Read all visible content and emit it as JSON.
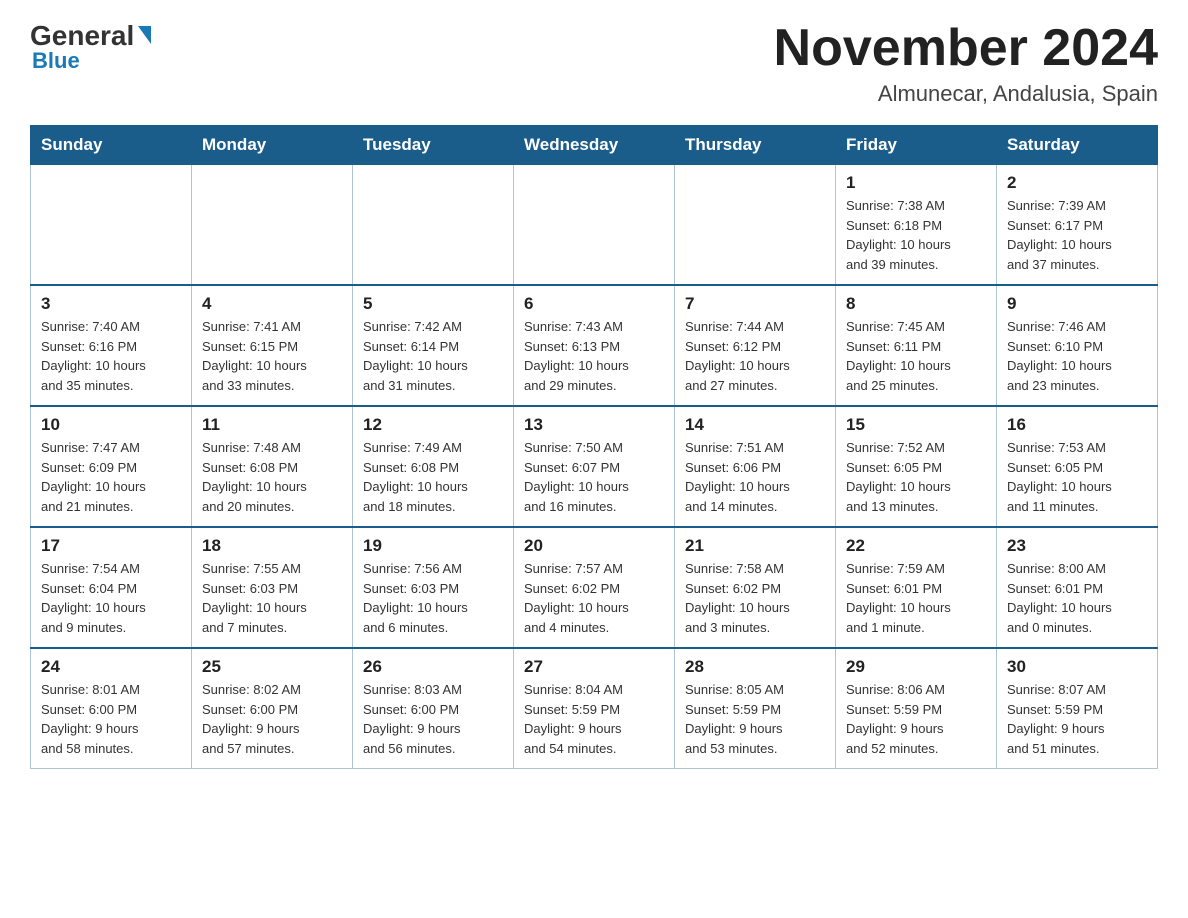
{
  "header": {
    "logo_text_general": "General",
    "logo_text_blue": "Blue",
    "month_title": "November 2024",
    "location": "Almunecar, Andalusia, Spain"
  },
  "weekdays": [
    "Sunday",
    "Monday",
    "Tuesday",
    "Wednesday",
    "Thursday",
    "Friday",
    "Saturday"
  ],
  "weeks": [
    {
      "days": [
        {
          "num": "",
          "info": ""
        },
        {
          "num": "",
          "info": ""
        },
        {
          "num": "",
          "info": ""
        },
        {
          "num": "",
          "info": ""
        },
        {
          "num": "",
          "info": ""
        },
        {
          "num": "1",
          "info": "Sunrise: 7:38 AM\nSunset: 6:18 PM\nDaylight: 10 hours\nand 39 minutes."
        },
        {
          "num": "2",
          "info": "Sunrise: 7:39 AM\nSunset: 6:17 PM\nDaylight: 10 hours\nand 37 minutes."
        }
      ]
    },
    {
      "days": [
        {
          "num": "3",
          "info": "Sunrise: 7:40 AM\nSunset: 6:16 PM\nDaylight: 10 hours\nand 35 minutes."
        },
        {
          "num": "4",
          "info": "Sunrise: 7:41 AM\nSunset: 6:15 PM\nDaylight: 10 hours\nand 33 minutes."
        },
        {
          "num": "5",
          "info": "Sunrise: 7:42 AM\nSunset: 6:14 PM\nDaylight: 10 hours\nand 31 minutes."
        },
        {
          "num": "6",
          "info": "Sunrise: 7:43 AM\nSunset: 6:13 PM\nDaylight: 10 hours\nand 29 minutes."
        },
        {
          "num": "7",
          "info": "Sunrise: 7:44 AM\nSunset: 6:12 PM\nDaylight: 10 hours\nand 27 minutes."
        },
        {
          "num": "8",
          "info": "Sunrise: 7:45 AM\nSunset: 6:11 PM\nDaylight: 10 hours\nand 25 minutes."
        },
        {
          "num": "9",
          "info": "Sunrise: 7:46 AM\nSunset: 6:10 PM\nDaylight: 10 hours\nand 23 minutes."
        }
      ]
    },
    {
      "days": [
        {
          "num": "10",
          "info": "Sunrise: 7:47 AM\nSunset: 6:09 PM\nDaylight: 10 hours\nand 21 minutes."
        },
        {
          "num": "11",
          "info": "Sunrise: 7:48 AM\nSunset: 6:08 PM\nDaylight: 10 hours\nand 20 minutes."
        },
        {
          "num": "12",
          "info": "Sunrise: 7:49 AM\nSunset: 6:08 PM\nDaylight: 10 hours\nand 18 minutes."
        },
        {
          "num": "13",
          "info": "Sunrise: 7:50 AM\nSunset: 6:07 PM\nDaylight: 10 hours\nand 16 minutes."
        },
        {
          "num": "14",
          "info": "Sunrise: 7:51 AM\nSunset: 6:06 PM\nDaylight: 10 hours\nand 14 minutes."
        },
        {
          "num": "15",
          "info": "Sunrise: 7:52 AM\nSunset: 6:05 PM\nDaylight: 10 hours\nand 13 minutes."
        },
        {
          "num": "16",
          "info": "Sunrise: 7:53 AM\nSunset: 6:05 PM\nDaylight: 10 hours\nand 11 minutes."
        }
      ]
    },
    {
      "days": [
        {
          "num": "17",
          "info": "Sunrise: 7:54 AM\nSunset: 6:04 PM\nDaylight: 10 hours\nand 9 minutes."
        },
        {
          "num": "18",
          "info": "Sunrise: 7:55 AM\nSunset: 6:03 PM\nDaylight: 10 hours\nand 7 minutes."
        },
        {
          "num": "19",
          "info": "Sunrise: 7:56 AM\nSunset: 6:03 PM\nDaylight: 10 hours\nand 6 minutes."
        },
        {
          "num": "20",
          "info": "Sunrise: 7:57 AM\nSunset: 6:02 PM\nDaylight: 10 hours\nand 4 minutes."
        },
        {
          "num": "21",
          "info": "Sunrise: 7:58 AM\nSunset: 6:02 PM\nDaylight: 10 hours\nand 3 minutes."
        },
        {
          "num": "22",
          "info": "Sunrise: 7:59 AM\nSunset: 6:01 PM\nDaylight: 10 hours\nand 1 minute."
        },
        {
          "num": "23",
          "info": "Sunrise: 8:00 AM\nSunset: 6:01 PM\nDaylight: 10 hours\nand 0 minutes."
        }
      ]
    },
    {
      "days": [
        {
          "num": "24",
          "info": "Sunrise: 8:01 AM\nSunset: 6:00 PM\nDaylight: 9 hours\nand 58 minutes."
        },
        {
          "num": "25",
          "info": "Sunrise: 8:02 AM\nSunset: 6:00 PM\nDaylight: 9 hours\nand 57 minutes."
        },
        {
          "num": "26",
          "info": "Sunrise: 8:03 AM\nSunset: 6:00 PM\nDaylight: 9 hours\nand 56 minutes."
        },
        {
          "num": "27",
          "info": "Sunrise: 8:04 AM\nSunset: 5:59 PM\nDaylight: 9 hours\nand 54 minutes."
        },
        {
          "num": "28",
          "info": "Sunrise: 8:05 AM\nSunset: 5:59 PM\nDaylight: 9 hours\nand 53 minutes."
        },
        {
          "num": "29",
          "info": "Sunrise: 8:06 AM\nSunset: 5:59 PM\nDaylight: 9 hours\nand 52 minutes."
        },
        {
          "num": "30",
          "info": "Sunrise: 8:07 AM\nSunset: 5:59 PM\nDaylight: 9 hours\nand 51 minutes."
        }
      ]
    }
  ]
}
